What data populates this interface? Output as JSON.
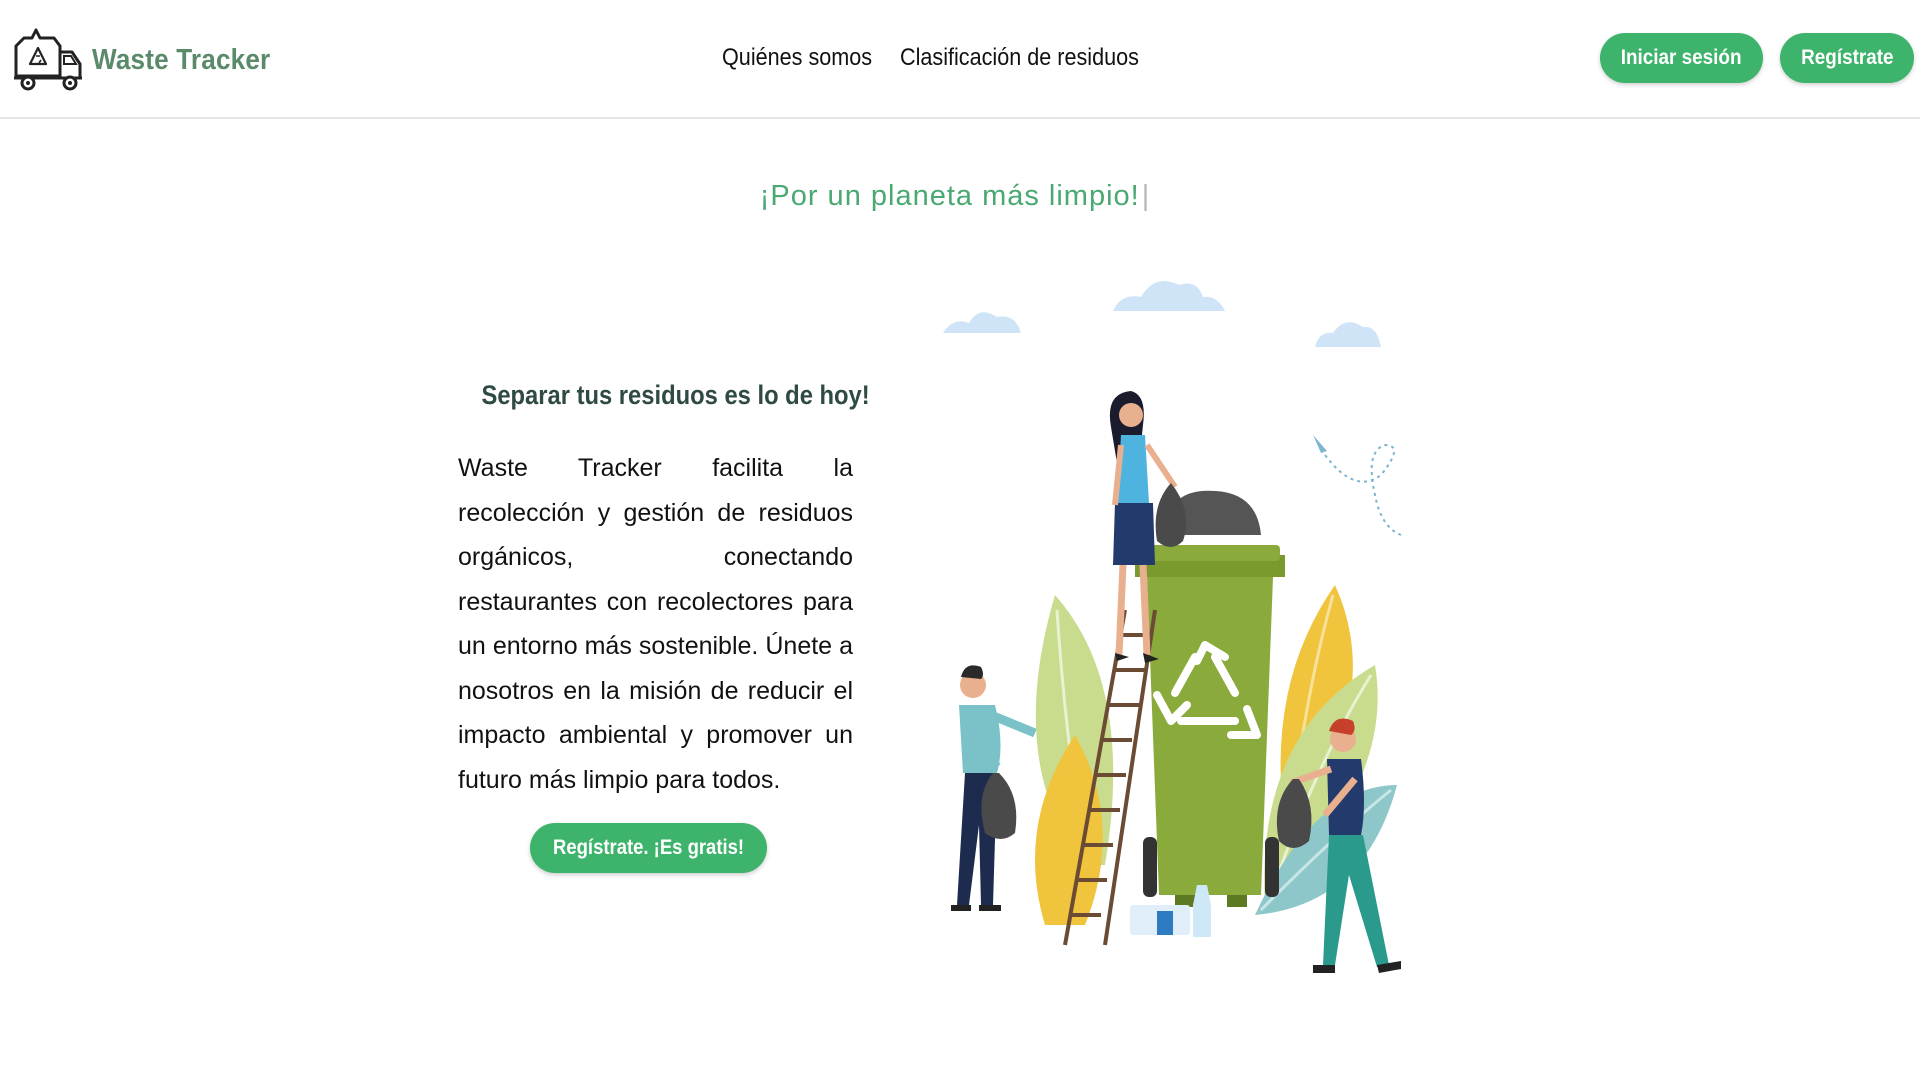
{
  "header": {
    "brand_name": "Waste Tracker",
    "logo_icon": "recycling-truck-icon",
    "nav": [
      {
        "label": "Quiénes somos"
      },
      {
        "label": "Clasificación de residuos"
      }
    ],
    "login_label": "Iniciar sesión",
    "register_label": "Regístrate"
  },
  "hero": {
    "tagline": "¡Por un planeta más limpio!",
    "tagline_caret": "|",
    "subtitle": "Separar tus residuos es lo de hoy!",
    "description": "Waste Tracker facilita la recolección y gestión de residuos orgánicos, conectando restaurantes con recolectores para un entorno más sostenible. Únete a nosotros en la misión de reducir el impacto ambiental y promover un futuro más limpio para todos.",
    "cta_label": "Regístrate. ¡Es gratis!",
    "illustration_icon": "recycling-bin-illustration-icon"
  },
  "colors": {
    "accent_green": "#3db36b",
    "brand_text": "#5a8a6a",
    "tagline_green": "#4aa872",
    "subtitle_dark": "#2f4a45",
    "bin_green": "#8aab3c"
  }
}
